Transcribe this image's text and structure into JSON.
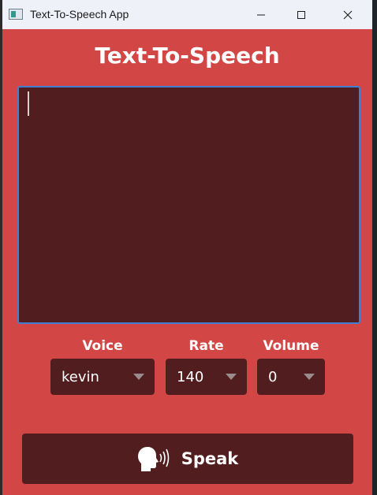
{
  "window": {
    "title": "Text-To-Speech App"
  },
  "app": {
    "heading": "Text-To-Speech",
    "text_input": {
      "value": "",
      "placeholder": ""
    },
    "controls": {
      "voice": {
        "label": "Voice",
        "selected": "kevin"
      },
      "rate": {
        "label": "Rate",
        "selected": "140"
      },
      "volume": {
        "label": "Volume",
        "selected": "0"
      }
    },
    "speak_button": {
      "label": "Speak",
      "icon": "speaking-head-icon"
    }
  },
  "colors": {
    "background": "#d24646",
    "panel": "#521d1f",
    "focus_border": "#3f7fd4",
    "text": "#ffffff"
  }
}
